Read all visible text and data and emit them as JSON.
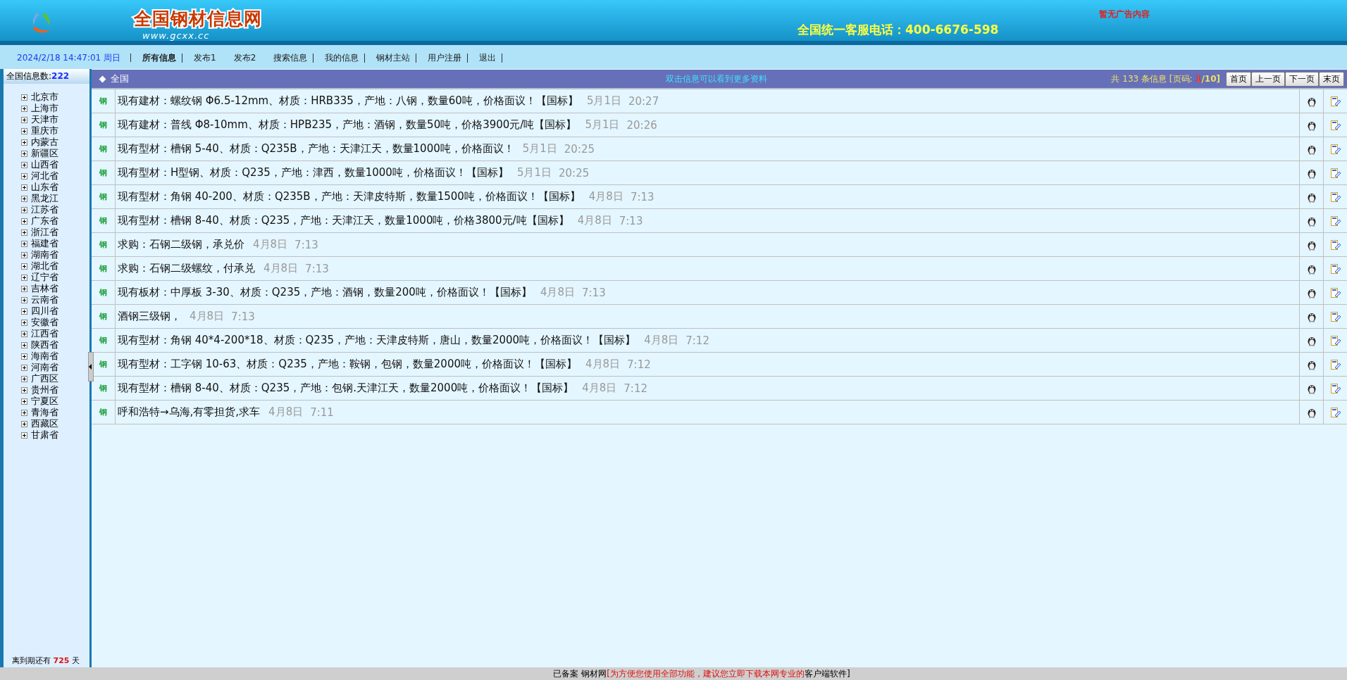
{
  "header": {
    "site_title": "全国钢材信息网",
    "site_url": "www.gcxx.cc",
    "hotline": "全国统一客服电话：400-6676-598",
    "ad": "暂无广告内容"
  },
  "nav": {
    "datetime": "2024/2/18 14:47:01 周日",
    "items": [
      {
        "label": "所有信息",
        "selected": true,
        "divider": true
      },
      {
        "label": "发布1",
        "selected": false,
        "divider": false
      },
      {
        "label": "发布2",
        "selected": false,
        "divider": false
      },
      {
        "label": "搜索信息",
        "selected": false,
        "divider": true
      },
      {
        "label": "我的信息",
        "selected": false,
        "divider": true
      },
      {
        "label": "钢材主站",
        "selected": false,
        "divider": true
      },
      {
        "label": "用户注册",
        "selected": false,
        "divider": true
      },
      {
        "label": "退出",
        "selected": false,
        "divider": true
      }
    ]
  },
  "sidebar": {
    "count_label": "全国信息数:",
    "count": "222",
    "regions": [
      {
        "label": "北京市",
        "expanded": false
      },
      {
        "label": "上海市",
        "expanded": false
      },
      {
        "label": "天津市",
        "expanded": false
      },
      {
        "label": "重庆市",
        "expanded": false
      },
      {
        "label": "内蒙古",
        "expanded": false
      },
      {
        "label": "新疆区",
        "expanded": false
      },
      {
        "label": "山西省",
        "expanded": false
      },
      {
        "label": "河北省",
        "expanded": false
      },
      {
        "label": "山东省",
        "expanded": false
      },
      {
        "label": "黑龙江",
        "expanded": false
      },
      {
        "label": "江苏省",
        "expanded": false
      },
      {
        "label": "广东省",
        "expanded": false
      },
      {
        "label": "浙江省",
        "expanded": false
      },
      {
        "label": "福建省",
        "expanded": false
      },
      {
        "label": "湖南省",
        "expanded": false
      },
      {
        "label": "湖北省",
        "expanded": false
      },
      {
        "label": "辽宁省",
        "expanded": false
      },
      {
        "label": "吉林省",
        "expanded": false
      },
      {
        "label": "云南省",
        "expanded": false
      },
      {
        "label": "四川省",
        "expanded": false
      },
      {
        "label": "安徽省",
        "expanded": false
      },
      {
        "label": "江西省",
        "expanded": false
      },
      {
        "label": "陕西省",
        "expanded": false
      },
      {
        "label": "海南省",
        "expanded": false
      },
      {
        "label": "河南省",
        "expanded": false
      },
      {
        "label": "广西区",
        "expanded": false
      },
      {
        "label": "贵州省",
        "expanded": false
      },
      {
        "label": "宁夏区",
        "expanded": false
      },
      {
        "label": "青海省",
        "expanded": false
      },
      {
        "label": "西藏区",
        "expanded": false
      },
      {
        "label": "甘肃省",
        "expanded": false
      }
    ],
    "expiry_prefix": "离到期还有",
    "expiry_days": "725",
    "expiry_suffix": "天"
  },
  "list": {
    "region": "全国",
    "hint": "双击信息可以看到更多资料",
    "total": "共 133 条信息",
    "page_label": "[页码:",
    "page_current": "1",
    "page_total": "/10]",
    "pager": [
      "首页",
      "上一页",
      "下一页",
      "末页"
    ],
    "rows": [
      {
        "badge": "钢",
        "text": "现有建材：螺纹钢 Φ6.5-12mm、材质：HRB335，产地：八钢，数量60吨，价格面议！【国标】",
        "date": "5月1日",
        "time": "20:27"
      },
      {
        "badge": "钢",
        "text": "现有建材：普线 Φ8-10mm、材质：HPB235，产地：酒钢，数量50吨，价格3900元/吨【国标】",
        "date": "5月1日",
        "time": "20:26"
      },
      {
        "badge": "钢",
        "text": "现有型材：槽钢 5-40、材质：Q235B，产地：天津江天，数量1000吨，价格面议！",
        "date": "5月1日",
        "time": "20:25"
      },
      {
        "badge": "钢",
        "text": "现有型材：H型钢、材质：Q235，产地：津西，数量1000吨，价格面议！【国标】",
        "date": "5月1日",
        "time": "20:25"
      },
      {
        "badge": "钢",
        "text": "现有型材：角钢 40-200、材质：Q235B，产地：天津皮特斯，数量1500吨，价格面议！【国标】",
        "date": "4月8日",
        "time": "7:13"
      },
      {
        "badge": "钢",
        "text": "现有型材：槽钢 8-40、材质：Q235，产地：天津江天，数量1000吨，价格3800元/吨【国标】",
        "date": "4月8日",
        "time": "7:13"
      },
      {
        "badge": "钢",
        "text": "求购：石钢二级钢，承兑价",
        "date": "4月8日",
        "time": "7:13"
      },
      {
        "badge": "钢",
        "text": "求购：石钢二级螺纹，付承兑",
        "date": "4月8日",
        "time": "7:13"
      },
      {
        "badge": "钢",
        "text": "现有板材：中厚板 3-30、材质：Q235，产地：酒钢，数量200吨，价格面议！【国标】",
        "date": "4月8日",
        "time": "7:13"
      },
      {
        "badge": "钢",
        "text": "酒钢三级钢，",
        "date": "4月8日",
        "time": "7:13"
      },
      {
        "badge": "钢",
        "text": "现有型材：角钢 40*4-200*18、材质：Q235，产地：天津皮特斯，唐山，数量2000吨，价格面议！【国标】",
        "date": "4月8日",
        "time": "7:12"
      },
      {
        "badge": "钢",
        "text": "现有型材：工字钢 10-63、材质：Q235，产地：鞍钢，包钢，数量2000吨，价格面议！【国标】",
        "date": "4月8日",
        "time": "7:12"
      },
      {
        "badge": "钢",
        "text": "现有型材：槽钢 8-40、材质：Q235，产地：包钢.天津江天，数量2000吨，价格面议！【国标】",
        "date": "4月8日",
        "time": "7:12"
      },
      {
        "badge": "钢",
        "text": "呼和浩特→乌海,有零担货,求车",
        "date": "4月8日",
        "time": "7:11"
      }
    ]
  },
  "footer": {
    "record": "已备案 钢材网",
    "notice": "[为方便您使用全部功能，建议您立即下载本网专业的",
    "tail": "客户端软件]"
  }
}
